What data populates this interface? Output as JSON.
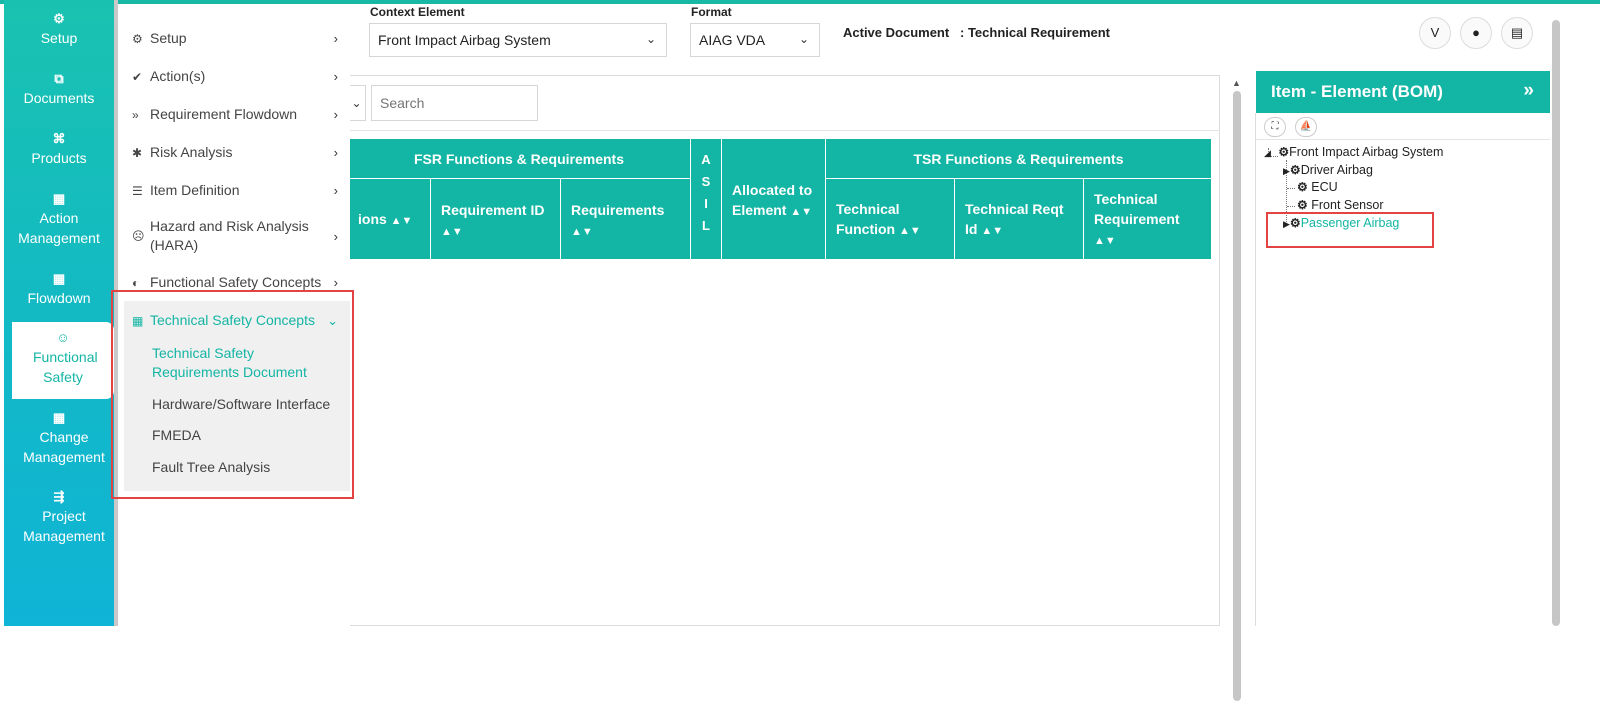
{
  "nav": {
    "items": [
      {
        "icon": "⚙",
        "label": "Setup"
      },
      {
        "icon": "⧉",
        "label": "Documents"
      },
      {
        "icon": "⌘",
        "label": "Products"
      },
      {
        "icon": "▦",
        "label": "Action Management"
      },
      {
        "icon": "▦",
        "label": "Flowdown"
      },
      {
        "icon": "☺",
        "label": "Functional Safety"
      },
      {
        "icon": "▦",
        "label": "Change Management"
      },
      {
        "icon": "⇶",
        "label": "Project Management"
      }
    ]
  },
  "flyout": {
    "items": [
      {
        "icon": "⚙",
        "label": "Setup"
      },
      {
        "icon": "✔",
        "label": "Action(s)"
      },
      {
        "icon": "»",
        "label": "Requirement Flowdown"
      },
      {
        "icon": "✱",
        "label": "Risk Analysis"
      },
      {
        "icon": "☰",
        "label": "Item Definition"
      },
      {
        "icon": "☹",
        "label": "Hazard and Risk Analysis (HARA)"
      },
      {
        "icon": "◐",
        "label": "Functional Safety Concepts"
      },
      {
        "icon": "▦",
        "label": "Technical Safety Concepts"
      }
    ],
    "subitems": [
      "Technical Safety Requirements Document",
      "Hardware/Software Interface",
      "FMEDA",
      "Fault Tree Analysis"
    ]
  },
  "topbar": {
    "context_label": "Context Element",
    "context_value": "Front Impact Airbag System",
    "format_label": "Format",
    "format_value": "AIAG VDA",
    "active_doc_label": "Active Document",
    "active_doc_value": ": Technical Requirement"
  },
  "main": {
    "search_placeholder": "Search",
    "fsr_group": "FSR Functions & Requirements",
    "tsr_group": "TSR Functions & Requirements",
    "col_functions_partial": "ions",
    "col_requirement_id": "Requirement ID",
    "col_requirements": "Requirements",
    "col_asil": "A S I L",
    "col_allocated": "Allocated to Element",
    "col_tech_function": "Technical Function",
    "col_tech_reqt_id": "Technical Reqt Id",
    "col_tech_requirement": "Technical Requirement"
  },
  "bom": {
    "title": "Item - Element (BOM)",
    "tree": {
      "root": "Front Impact Airbag System",
      "children": [
        "Driver Airbag",
        "ECU",
        "Front Sensor",
        "Passenger Airbag"
      ]
    }
  }
}
